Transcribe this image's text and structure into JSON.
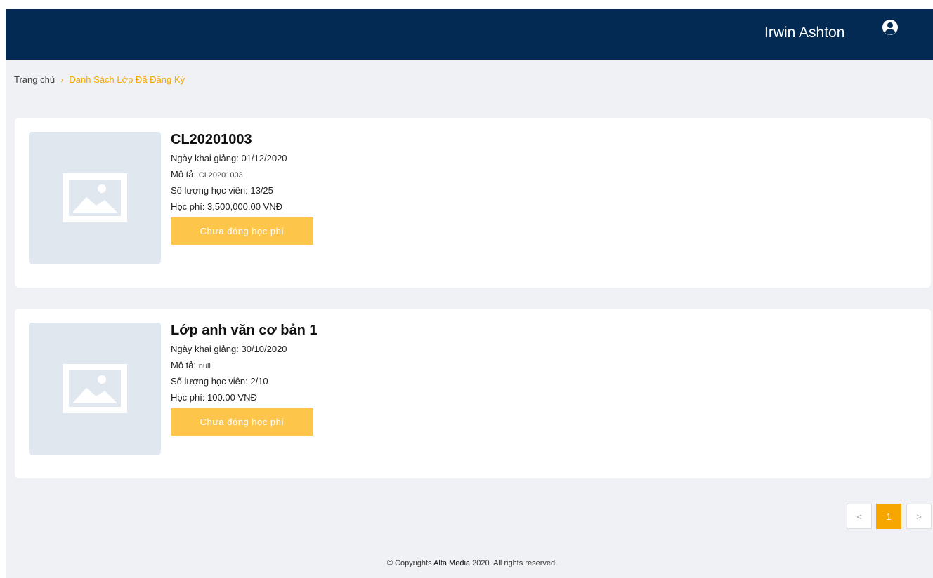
{
  "header": {
    "username": "Irwin Ashton",
    "user_icon": "user-circle-icon"
  },
  "breadcrumb": {
    "home": "Trang chủ",
    "separator": "›",
    "current": "Danh Sách Lớp Đã Đăng Ký"
  },
  "classes": [
    {
      "title": "CL20201003",
      "start_label": "Ngày khai giảng:",
      "start_value": "01/12/2020",
      "desc_label": "Mô tả:",
      "desc_value": "CL20201003",
      "students_label": "Số lượng học viên:",
      "students_value": "13/25",
      "fee_label": "Học phí:",
      "fee_value": "3,500,000.00 VNĐ",
      "button_label": "Chưa đóng học phí"
    },
    {
      "title": "Lớp anh văn cơ bản 1",
      "start_label": "Ngày khai giảng:",
      "start_value": "30/10/2020",
      "desc_label": "Mô tả:",
      "desc_value": "null",
      "students_label": "Số lượng học viên:",
      "students_value": "2/10",
      "fee_label": "Học phí:",
      "fee_value": "100.00 VNĐ",
      "button_label": "Chưa đóng học phí"
    }
  ],
  "pagination": {
    "prev": "<",
    "current": "1",
    "next": ">"
  },
  "footer": {
    "prefix": "© Copyrights ",
    "brand": "Alta Media",
    "suffix": " 2020. All rights reserved."
  },
  "colors": {
    "header_bg": "#032a53",
    "accent": "#f7a600",
    "button_bg": "#fdc64b",
    "page_bg": "#f0f1f5"
  }
}
